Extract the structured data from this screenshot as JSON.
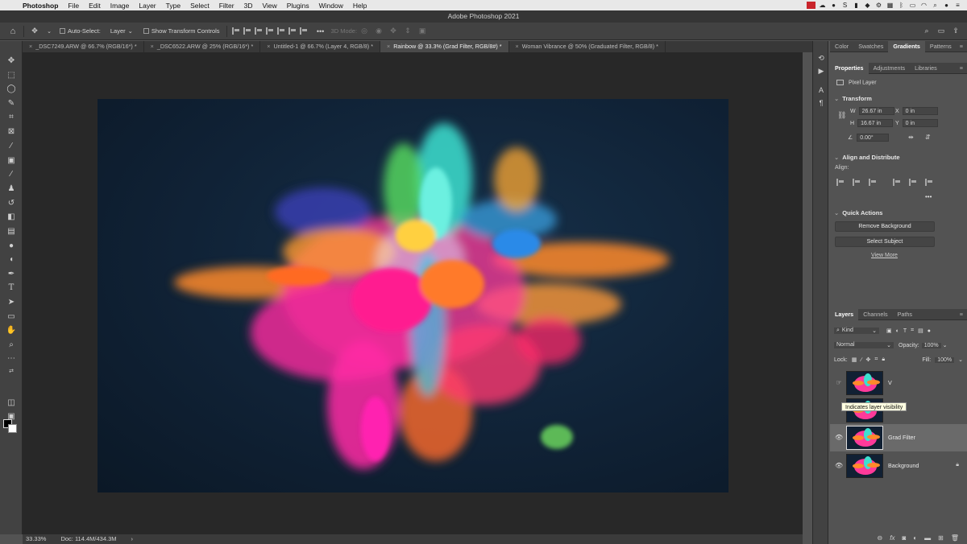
{
  "menubar": {
    "app": "Photoshop",
    "items": [
      "File",
      "Edit",
      "Image",
      "Layer",
      "Type",
      "Select",
      "Filter",
      "3D",
      "View",
      "Plugins",
      "Window",
      "Help"
    ]
  },
  "window": {
    "title": "Adobe Photoshop 2021"
  },
  "options": {
    "auto_select": "Auto-Select:",
    "layer_select": "Layer",
    "show_transform": "Show Transform Controls",
    "mode_3d": "3D Mode:",
    "more": "•••"
  },
  "tabs": [
    {
      "label": "_DSC7249.ARW @ 66.7% (RGB/16*) *",
      "active": false
    },
    {
      "label": "_DSC6522.ARW @ 25% (RGB/16*) *",
      "active": false
    },
    {
      "label": "Untitled-1 @ 66.7% (Layer 4, RGB/8) *",
      "active": false
    },
    {
      "label": "Rainbow @ 33.3% (Grad Filter, RGB/8#) *",
      "active": true
    },
    {
      "label": "Woman Vibrance @ 50% (Graduated Filter, RGB/8) *",
      "active": false
    }
  ],
  "status": {
    "zoom": "33.33%",
    "doc": "Doc: 114.4M/434.3M",
    "arrow": "›"
  },
  "panel_top_tabs": [
    "Color",
    "Swatches",
    "Gradients",
    "Patterns"
  ],
  "panel_top_active": "Gradients",
  "props_tabs": [
    "Properties",
    "Adjustments",
    "Libraries"
  ],
  "props_active": "Properties",
  "properties": {
    "kind": "Pixel Layer",
    "transform_title": "Transform",
    "w_label": "W",
    "w_value": "26.67 in",
    "h_label": "H",
    "h_value": "16.67 in",
    "x_label": "X",
    "x_value": "0 in",
    "y_label": "Y",
    "y_value": "0 in",
    "angle_value": "0.00°",
    "align_title": "Align and Distribute",
    "align_label": "Align:",
    "more": "•••",
    "quick_title": "Quick Actions",
    "remove_bg": "Remove Background",
    "select_subject": "Select Subject",
    "view_more": "View More"
  },
  "layers_panel": {
    "tabs": [
      "Layers",
      "Channels",
      "Paths"
    ],
    "active_tab": "Layers",
    "kind": "Kind",
    "blend": "Normal",
    "opacity_label": "Opacity:",
    "opacity_value": "100%",
    "lock_label": "Lock:",
    "fill_label": "Fill:",
    "fill_value": "100%",
    "tooltip": "Indicates layer visibility",
    "layers": [
      {
        "name": "V",
        "active": false
      },
      {
        "name": "",
        "active": false
      },
      {
        "name": "Grad Filter",
        "active": true
      },
      {
        "name": "Background",
        "active": false,
        "locked": true
      }
    ]
  },
  "colors": {
    "canvas_bg": "#102236",
    "accent_pink": "#ff2a9a",
    "accent_cyan": "#3de0d8",
    "accent_orange": "#ff7a1f"
  }
}
